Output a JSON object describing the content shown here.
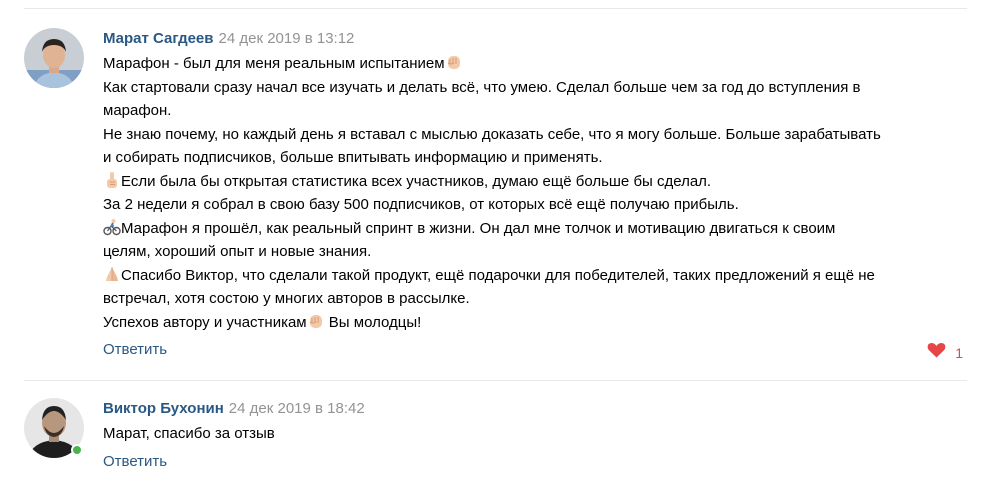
{
  "comments": [
    {
      "author": "Марат Сагдеев",
      "date": "24 дек 2019 в 13:12",
      "lines": [
        "Марафон - был для меня реальным испытанием",
        "Как стартовали сразу начал все изучать и делать всё, что умею. Сделал больше чем за год до вступления в",
        "марафон.",
        "Не знаю почему, но каждый день я вставал с мыслью доказать себе, что я могу больше. Больше зарабатывать",
        "и собирать подписчиков, больше впитывать информацию и применять.",
        "Если была бы открытая статистика всех участников, думаю ещё больше бы сделал.",
        "За 2 недели я собрал в свою базу 500 подписчиков, от которых всё ещё получаю прибыль.",
        "Марафон я прошёл, как реальный спринт в жизни. Он дал мне толчок и мотивацию двигаться к своим",
        "целям, хороший опыт и новые знания.",
        "Спасибо Виктор, что сделали такой продукт, ещё подарочки для победителей, таких предложений я ещё не",
        "встречал, хотя состою у многих авторов в рассылке.",
        "Успехов автору и участникам",
        "Вы молодцы!"
      ],
      "emoji": {
        "fist": "raised-fist-emoji",
        "finger": "index-pointing-up-emoji",
        "bike": "cyclist-emoji",
        "hands": "folded-hands-emoji"
      },
      "reply_label": "Ответить",
      "likes": "1"
    },
    {
      "author": "Виктор Бухонин",
      "date": "24 дек 2019 в 18:42",
      "lines": [
        "Марат, спасибо за отзыв"
      ],
      "reply_label": "Ответить"
    }
  ],
  "colors": {
    "link": "#2a5885",
    "date": "#939393",
    "like": "#e64646",
    "online": "#4bb34b",
    "divider": "#e7e8ec"
  }
}
